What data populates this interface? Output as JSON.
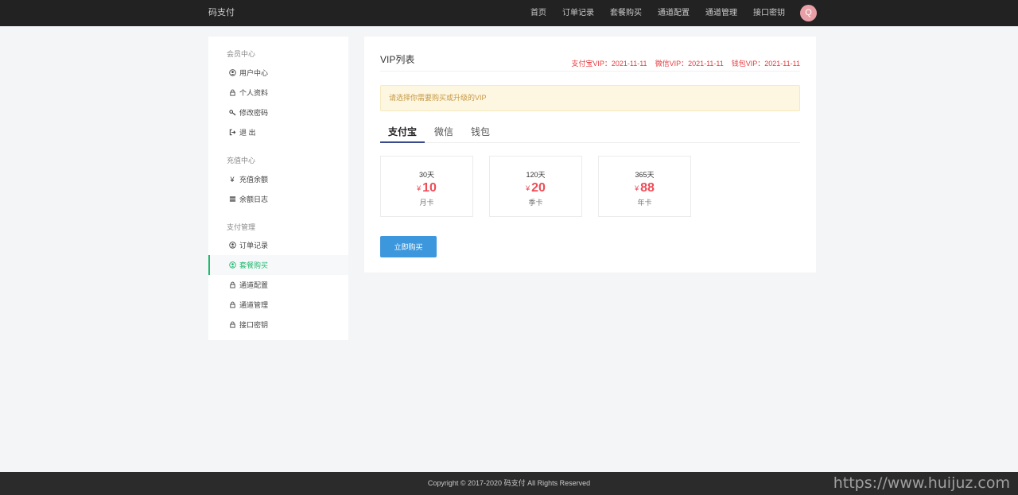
{
  "header": {
    "brand": "码支付",
    "nav": [
      "首页",
      "订单记录",
      "套餐购买",
      "通道配置",
      "通道管理",
      "接口密钥"
    ],
    "avatar_letter": "Q"
  },
  "sidebar": {
    "groups": [
      {
        "title": "会员中心",
        "items": [
          {
            "label": "用户中心",
            "icon": "user-circle-icon"
          },
          {
            "label": "个人资料",
            "icon": "lock-icon"
          },
          {
            "label": "修改密码",
            "icon": "key-icon"
          },
          {
            "label": "退 出",
            "icon": "logout-icon"
          }
        ]
      },
      {
        "title": "充值中心",
        "items": [
          {
            "label": "充值余额",
            "icon": "yen-icon"
          },
          {
            "label": "余额日志",
            "icon": "list-icon"
          }
        ]
      },
      {
        "title": "支付管理",
        "items": [
          {
            "label": "订单记录",
            "icon": "user-circle-icon"
          },
          {
            "label": "套餐购买",
            "icon": "user-circle-icon",
            "active": true
          },
          {
            "label": "通道配置",
            "icon": "lock-icon"
          },
          {
            "label": "通道管理",
            "icon": "lock-icon"
          },
          {
            "label": "接口密钥",
            "icon": "lock-icon"
          }
        ]
      }
    ]
  },
  "main": {
    "title": "VIP列表",
    "vip_status": [
      "支付宝VIP：2021-11-11",
      "微信VIP：2021-11-11",
      "钱包VIP：2021-11-11"
    ],
    "notice": "请选择你需要购买或升级的VIP",
    "tabs": [
      {
        "label": "支付宝",
        "active": true
      },
      {
        "label": "微信"
      },
      {
        "label": "钱包"
      }
    ],
    "plans": [
      {
        "days": "30天",
        "currency": "¥",
        "price": "10",
        "name": "月卡"
      },
      {
        "days": "120天",
        "currency": "¥",
        "price": "20",
        "name": "季卡"
      },
      {
        "days": "365天",
        "currency": "¥",
        "price": "88",
        "name": "年卡"
      }
    ],
    "buy_button": "立即购买"
  },
  "footer": {
    "copyright": "Copyright © 2017-2020 码支付 All Rights Reserved",
    "watermark": "https://www.huijuz.com"
  },
  "colors": {
    "topbar": "#222222",
    "accent_green": "#1fb96e",
    "price_red": "#ef4b57",
    "button_blue": "#3c97dd"
  }
}
